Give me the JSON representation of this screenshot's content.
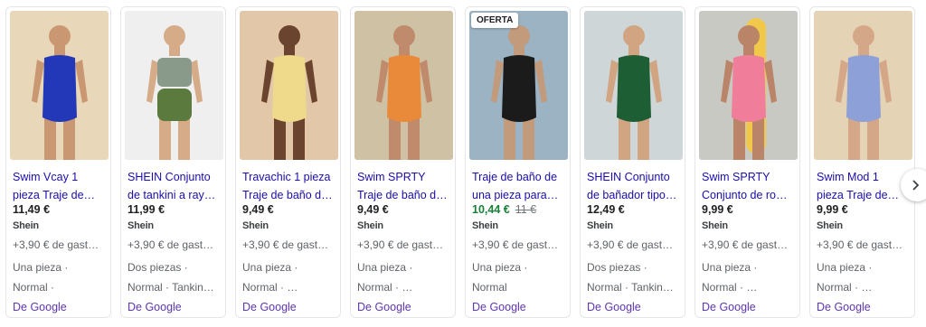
{
  "products": [
    {
      "title_line1": "Swim Vcay 1",
      "title_line2": "pieza Traje de…",
      "price": "11,49 €",
      "seller": "Shein",
      "shipping": "+3,90 € de gast…",
      "attr1": "Una pieza ·",
      "attr2": "Normal ·",
      "source": "De Google",
      "image": {
        "bg": "#e8d7b8",
        "suit": "#2338b8",
        "skin": "#c99872"
      }
    },
    {
      "title_line1": "SHEIN Conjunto",
      "title_line2": "de tankini a ray…",
      "price": "11,99 €",
      "seller": "Shein",
      "shipping": "+3,90 € de gast…",
      "attr1": "Dos piezas ·",
      "attr2": "Normal · Tankin…",
      "source": "De Google",
      "image": {
        "bg": "#efefef",
        "suit": "#5b7a3e",
        "top": "#8a9a8a",
        "skin": "#d6ab88"
      }
    },
    {
      "title_line1": "Travachic 1 pieza",
      "title_line2": "Traje de baño d…",
      "price": "9,49 €",
      "seller": "Shein",
      "shipping": "+3,90 € de gast…",
      "attr1": "Una pieza ·",
      "attr2": "Normal · …",
      "source": "De Google",
      "image": {
        "bg": "#e2c7a8",
        "suit": "#efd98a",
        "skin": "#6b4430"
      }
    },
    {
      "title_line1": "Swim SPRTY",
      "title_line2": "Traje de baño d…",
      "price": "9,49 €",
      "seller": "Shein",
      "shipping": "+3,90 € de gast…",
      "attr1": "Una pieza ·",
      "attr2": "Normal · …",
      "source": "De Google",
      "image": {
        "bg": "#cfc1a3",
        "suit": "#e88a3a",
        "skin": "#c08a6c"
      }
    },
    {
      "badge": "OFERTA",
      "title_line1": "Traje de baño de",
      "title_line2": "una pieza para…",
      "price_sale": "10,44 €",
      "price_old": "11 €",
      "seller": "Shein",
      "shipping": "+3,90 € de gast…",
      "attr1": "Una pieza ·",
      "attr2": "Normal",
      "source": "De Google",
      "image": {
        "bg": "#9bb3c3",
        "suit": "#1b1b1b",
        "skin": "#c29a7c"
      }
    },
    {
      "title_line1": "SHEIN Conjunto",
      "title_line2": "de bañador tipo…",
      "price": "12,49 €",
      "seller": "Shein",
      "shipping": "+3,90 € de gast…",
      "attr1": "Dos piezas ·",
      "attr2": "Normal · Tankin…",
      "source": "De Google",
      "image": {
        "bg": "#cfd6d8",
        "suit": "#1e5e34",
        "skin": "#d2a582"
      }
    },
    {
      "title_line1": "Swim SPRTY",
      "title_line2": "Conjunto de ro…",
      "price": "9,99 €",
      "seller": "Shein",
      "shipping": "+3,90 € de gast…",
      "attr1": "Una pieza ·",
      "attr2": "Normal · …",
      "source": "De Google",
      "image": {
        "bg": "#c9c9c4",
        "suit": "#f07e9a",
        "board": "#f2c84b",
        "skin": "#b98467"
      }
    },
    {
      "title_line1": "Swim Mod 1",
      "title_line2": "pieza Traje de…",
      "price": "9,99 €",
      "seller": "Shein",
      "shipping": "+3,90 € de gast…",
      "attr1": "Una pieza ·",
      "attr2": "Normal · …",
      "source": "De Google",
      "image": {
        "bg": "#e5d3b5",
        "suit": "#8da0d8",
        "skin": "#d5a789"
      }
    }
  ],
  "next_button_icon": "chevron-right-icon"
}
